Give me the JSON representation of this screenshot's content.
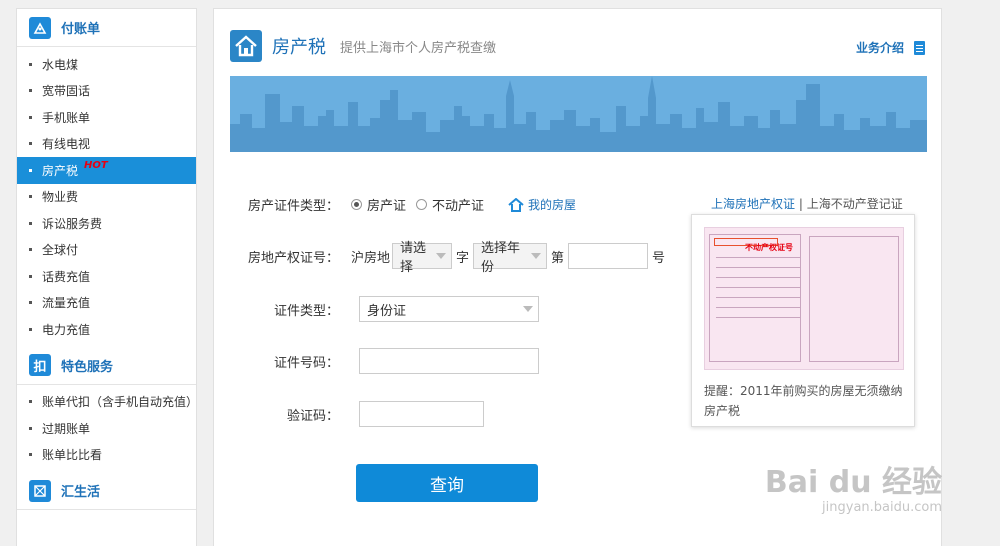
{
  "sidebar": {
    "sections": [
      {
        "icon": "pay-bill-icon",
        "title": "付账单",
        "items": [
          "水电煤",
          "宽带固话",
          "手机账单",
          "有线电视",
          "房产税",
          "物业费",
          "诉讼服务费",
          "全球付",
          "话费充值",
          "流量充值",
          "电力充值"
        ]
      },
      {
        "icon": "deduct-icon",
        "icon_char": "扣",
        "title": "特色服务",
        "items": [
          "账单代扣（含手机自动充值）",
          "过期账单",
          "账单比比看"
        ]
      },
      {
        "icon": "life-icon",
        "title": "汇生活",
        "items": []
      }
    ],
    "active_item": "房产税",
    "hot_badge": "HOT"
  },
  "header": {
    "title": "房产税",
    "subtitle": "提供上海市个人房产税查缴",
    "intro_label": "业务介绍"
  },
  "form": {
    "cert_type_label": "房产证件类型：",
    "radio_options": [
      "房产证",
      "不动产证"
    ],
    "radio_selected": "房产证",
    "my_house_label": "我的房屋",
    "cert_no_label": "房地产权证号：",
    "cert_prefix": "沪房地",
    "district_select": "请选择",
    "char_label": "字",
    "year_select": "选择年份",
    "di_label": "第",
    "hao_label": "号",
    "id_type_label": "证件类型：",
    "id_type_value": "身份证",
    "id_no_label": "证件号码：",
    "captcha_label": "验证码：",
    "submit_label": "查询"
  },
  "aside": {
    "link_a": "上海房地产权证",
    "separator": " | ",
    "link_b": "上海不动产登记证",
    "cert_tag": "不动产权证号",
    "tip": "提醒：2011年前购买的房屋无须缴纳房产税"
  },
  "watermark": {
    "main": "Bai du 经验",
    "url": "jingyan.baidu.com"
  },
  "colors": {
    "accent": "#1a8fd9",
    "button": "#0f8ad8",
    "hot": "#e60012",
    "banner": "#6aafe0"
  }
}
